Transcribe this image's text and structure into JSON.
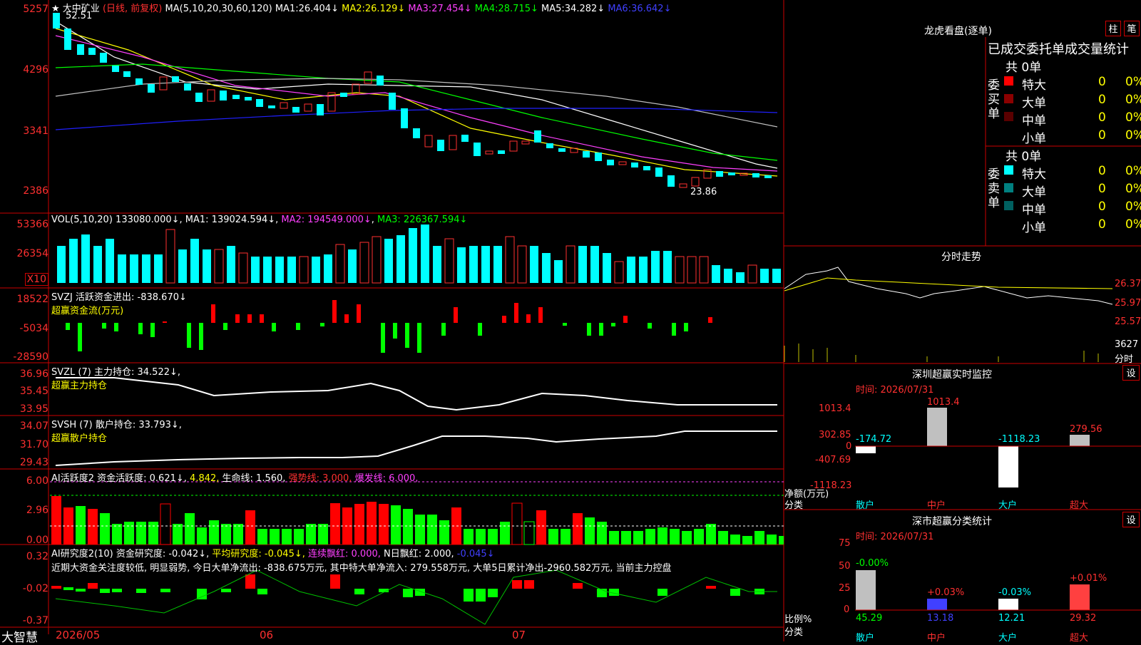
{
  "header": {
    "star": "★",
    "stock": "大中矿业",
    "period": "(日线, 前复权)",
    "ma_label": "MA(5,10,20,30,60,120)",
    "ma": [
      [
        "MA1:",
        "26.404↓"
      ],
      [
        "MA2:",
        "26.129↓"
      ],
      [
        "MA3:",
        "27.454↓"
      ],
      [
        "MA4:",
        "28.715↓"
      ],
      [
        "MA5:",
        "34.282↓"
      ],
      [
        "MA6:",
        "36.642↓"
      ]
    ],
    "high": "52.51",
    "low": "23.86"
  },
  "axes": {
    "price": [
      "5257",
      "4296",
      "3341",
      "2386"
    ],
    "vol": [
      "53366",
      "26354"
    ],
    "x10": "X10",
    "svzj": [
      "18522",
      "-5034",
      "-28590"
    ],
    "svzl": [
      "36.96",
      "35.45",
      "33.95"
    ],
    "svsh": [
      "34.07",
      "31.70",
      "29.43"
    ],
    "ai1": [
      "6.00",
      "2.96",
      "0.00"
    ],
    "ai2": [
      "0.32",
      "-0.02",
      "-0.37"
    ]
  },
  "vol": {
    "title": "VOL(5,10,20)",
    "v": "133080.000↓",
    "ma1": "MA1: 139024.594↓",
    "ma2": "MA2: 194549.000↓",
    "ma3": "MA3: 226367.594↓"
  },
  "svzj": {
    "title": "SVZJ",
    "item": "活跃资金进出: -838.670↓",
    "sub": "超赢资金流(万元)"
  },
  "svzl": {
    "title": "SVZL (7)",
    "item": "主力持仓: 34.522↓,",
    "sub": "超赢主力持仓"
  },
  "svsh": {
    "title": "SVSH (7)",
    "item": "散户持仓: 33.793↓,",
    "sub": "超赢散户持仓"
  },
  "ai1": {
    "title": "AI活跃度2",
    "a": "资金活跃度: 0.621↓,",
    "b": "4.842,",
    "c": "生命线: 1.560,",
    "d": "强势线: 3.000,",
    "e": "爆发线: 6.000,"
  },
  "ai2": {
    "title": "AI研究度2(10)",
    "a": "资金研究度: -0.042↓,",
    "b": "平均研究度: -0.045↓,",
    "c": "连续飘红: 0.000,",
    "d": "N日飘红: 2.000,",
    "e": "-0.045↓",
    "text": "近期大资金关注度较低, 明显弱势, 今日大单净流出: -838.675万元, 其中特大单净流入: 279.558万元, 大单5日累计净出-2960.582万元, 当前主力控盘"
  },
  "dates": [
    "2026/05",
    "06",
    "07"
  ],
  "brand": "大智慧",
  "right": {
    "lhb_title": "龙虎看盘(逐单)",
    "btn_zhu": "柱",
    "btn_bi": "笔",
    "stats_title": "已成交委托单成交量统计",
    "buy": {
      "side": "委买单",
      "total": "共 0单",
      "rows": [
        [
          "特大",
          "0",
          "0%"
        ],
        [
          "大单",
          "0",
          "0%"
        ],
        [
          "中单",
          "0",
          "0%"
        ],
        [
          "小单",
          "0",
          "0%"
        ]
      ]
    },
    "sell": {
      "side": "委卖单",
      "total": "共 0单",
      "rows": [
        [
          "特大",
          "0",
          "0%"
        ],
        [
          "大单",
          "0",
          "0%"
        ],
        [
          "中单",
          "0",
          "0%"
        ],
        [
          "小单",
          "0",
          "0%"
        ]
      ]
    },
    "fs_title": "分时走势",
    "fs_axis": [
      "26.37",
      "25.97",
      "25.57"
    ],
    "fs_vol": "3627",
    "fs_unit": "分时",
    "sz_title": "深圳超赢实时监控",
    "time1": "时间: 2026/07/31",
    "sz_axis": [
      "1013.4",
      "302.85",
      "0",
      "-407.69",
      "-1118.23"
    ],
    "sz_vals": [
      "-174.72",
      "1013.4",
      "-1118.23",
      "279.56"
    ],
    "net": "净额(万元)",
    "cls": "分类",
    "cats": [
      "散户",
      "中户",
      "大户",
      "超大"
    ],
    "fl_title": "深市超赢分类统计",
    "time2": "时间: 2026/07/31",
    "fl_axis": [
      "75",
      "50",
      "25",
      "0"
    ],
    "fl_top": [
      "-0.00%",
      "+0.03%",
      "-0.03%",
      "+0.01%"
    ],
    "fl_vals": [
      "45.29",
      "13.18",
      "12.21",
      "29.32"
    ],
    "ratio": "比例%",
    "set": "设"
  }
}
